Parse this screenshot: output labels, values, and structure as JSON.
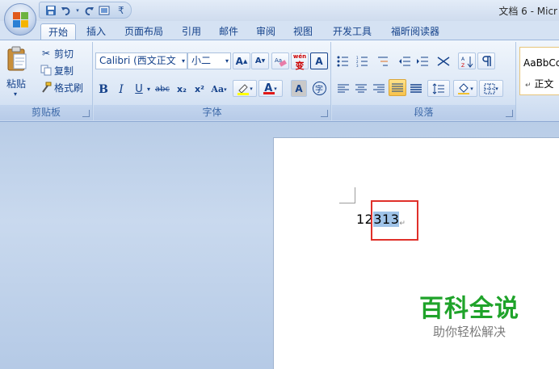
{
  "window": {
    "title": "文档 6 - Micr"
  },
  "quick_access": {
    "items": [
      "save-icon",
      "undo-icon",
      "redo-icon",
      "print-preview-icon",
      "customize-icon"
    ]
  },
  "tabs": [
    "开始",
    "插入",
    "页面布局",
    "引用",
    "邮件",
    "审阅",
    "视图",
    "开发工具",
    "福昕阅读器"
  ],
  "active_tab": "开始",
  "clipboard": {
    "paste_label": "粘贴",
    "cut_label": "剪切",
    "copy_label": "复制",
    "format_painter_label": "格式刷",
    "group_label": "剪贴板"
  },
  "font": {
    "family_value": "Calibri (西文正文",
    "size_value": "小二",
    "group_label": "字体",
    "bold": "B",
    "italic": "I",
    "underline": "U",
    "strikethrough": "abc",
    "subscript": "x₂",
    "superscript": "x²",
    "change_case": "Aa",
    "grow": "A",
    "shrink": "A",
    "phonetic": "wén",
    "border": "A",
    "shading": "A",
    "enclose": "字",
    "highlight_color": "#ffff00",
    "font_color": "#e01818"
  },
  "paragraph": {
    "group_label": "段落"
  },
  "styles": {
    "preview_text": "AaBbCc",
    "style_name": "正文"
  },
  "document": {
    "text_prefix": "12",
    "text_selected": "313"
  },
  "watermark": {
    "title": "百科全说",
    "subtitle": "助你轻松解决"
  },
  "colors": {
    "selection": "#9fc3e8",
    "annotation_box": "#e0302a",
    "watermark_green": "#1fa32a"
  }
}
